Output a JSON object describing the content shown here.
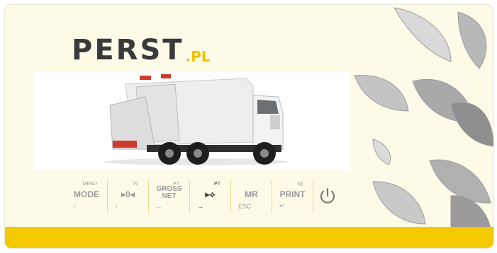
{
  "brand": {
    "name": "PERST",
    "suffix": ".PL"
  },
  "colors": {
    "panel": "#fdfbe8",
    "accent": "#f4c900",
    "key_text": "#9a9a9a",
    "key_text_active": "#333333"
  },
  "keys": [
    {
      "label": "MODE",
      "super": "MENU",
      "sub": "↑"
    },
    {
      "label": "▸0◂",
      "super": "T0",
      "sub": "↑"
    },
    {
      "label": "GROSS",
      "label2": "NET",
      "super": "PT",
      "sub": "←"
    },
    {
      "label": "▸⟡",
      "super": "PT",
      "sub": "→"
    },
    {
      "label": "MR",
      "super": "",
      "sub": "ESC"
    },
    {
      "label": "PRINT",
      "super": "kg",
      "sub": "↵"
    }
  ],
  "power": {
    "icon": "power-icon"
  }
}
